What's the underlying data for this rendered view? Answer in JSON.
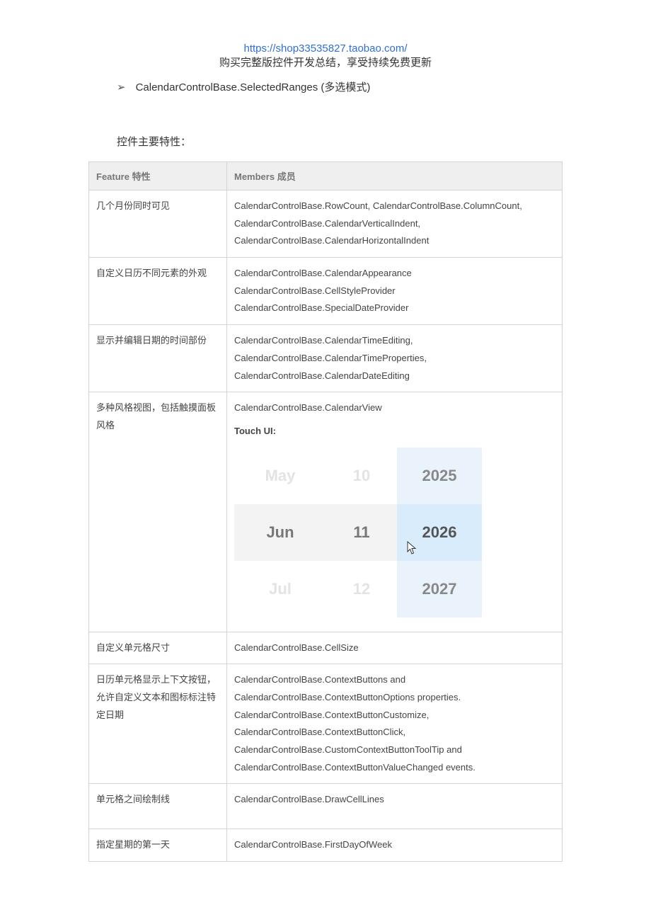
{
  "header": {
    "url": "https://shop33535827.taobao.com/",
    "line2": "购买完整版控件开发总结，享受持续免费更新"
  },
  "bullet": {
    "text": "CalendarControlBase.SelectedRanges (多选模式)"
  },
  "section_title": "控件主要特性：",
  "table": {
    "head_feature": "Feature 特性",
    "head_members": "Members 成员",
    "rows": [
      {
        "feature": "几个月份同时可见",
        "members": "CalendarControlBase.RowCount, CalendarControlBase.ColumnCount, CalendarControlBase.CalendarVerticalIndent, CalendarControlBase.CalendarHorizontalIndent"
      },
      {
        "feature": "自定义日历不同元素的外观",
        "members": "CalendarControlBase.CalendarAppearance CalendarControlBase.CellStyleProvider CalendarControlBase.SpecialDateProvider"
      },
      {
        "feature": "显示并编辑日期的时间部份",
        "members": "CalendarControlBase.CalendarTimeEditing, CalendarControlBase.CalendarTimeProperties, CalendarControlBase.CalendarDateEditing"
      },
      {
        "feature": "多种风格视图，包括触摸面板风格",
        "members_line1": "CalendarControlBase.CalendarView",
        "touch_label": "Touch UI:"
      },
      {
        "feature": "自定义单元格尺寸",
        "members": "CalendarControlBase.CellSize"
      },
      {
        "feature": "日历单元格显示上下文按钮，允许自定义文本和图标标注特定日期",
        "members": "CalendarControlBase.ContextButtons and CalendarControlBase.ContextButtonOptions properties. CalendarControlBase.ContextButtonCustomize, CalendarControlBase.ContextButtonClick, CalendarControlBase.CustomContextButtonToolTip and CalendarControlBase.ContextButtonValueChanged events."
      },
      {
        "feature": "单元格之间绘制线",
        "members": "CalendarControlBase.DrawCellLines"
      },
      {
        "feature": "指定星期的第一天",
        "members": "CalendarControlBase.FirstDayOfWeek"
      }
    ]
  },
  "touchui": {
    "rows": [
      {
        "month": "May",
        "day": "10",
        "year": "2025"
      },
      {
        "month": "Jun",
        "day": "11",
        "year": "2026"
      },
      {
        "month": "Jul",
        "day": "12",
        "year": "2027"
      }
    ]
  }
}
